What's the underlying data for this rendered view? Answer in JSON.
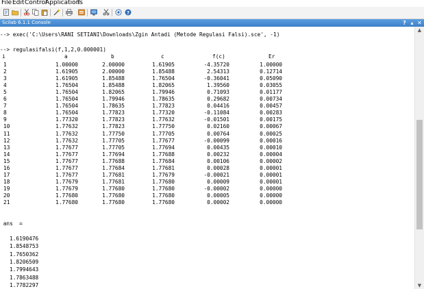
{
  "menu": [
    "File",
    "Edit",
    "Control",
    "Applications",
    "?"
  ],
  "toolbar": [
    "new-script-icon",
    "open-file-icon",
    "cut-icon",
    "copy-icon",
    "paste-icon",
    "wand-icon",
    "print-icon",
    "print-preview-icon",
    "variable-browser-icon",
    "scissors-icon",
    "settings-icon",
    "help-icon"
  ],
  "window": {
    "title": "Scilab 6.1.1 Console",
    "buttons": [
      "?",
      "▴",
      "✕"
    ]
  },
  "console": {
    "exec_line": "--> exec('C:\\Users\\RANI SETIANI\\Downloads\\Zgin Antadi (Metode Regulasi Falsi).sce', -1)",
    "call_line": "--> regulasifalsi(f,1,2,0.000001)",
    "table": {
      "headers": [
        "i",
        "a",
        "b",
        "c",
        "f(c)",
        "Er"
      ],
      "rows": [
        [
          "1",
          "1.00000",
          "2.00000",
          "1.61905",
          "-4.35720",
          "1.00000"
        ],
        [
          "2",
          "1.61905",
          "2.00000",
          "1.85488",
          "2.54313",
          "0.12714"
        ],
        [
          "3",
          "1.61905",
          "1.85488",
          "1.76504",
          "-0.36041",
          "0.05090"
        ],
        [
          "4",
          "1.76504",
          "1.85488",
          "1.82065",
          "1.39560",
          "0.03055"
        ],
        [
          "5",
          "1.76504",
          "1.82065",
          "1.79946",
          "0.71093",
          "0.01177"
        ],
        [
          "6",
          "1.76504",
          "1.79946",
          "1.78635",
          "0.29682",
          "0.00734"
        ],
        [
          "7",
          "1.76504",
          "1.78635",
          "1.77823",
          "0.04416",
          "0.00457"
        ],
        [
          "8",
          "1.76504",
          "1.77823",
          "1.77320",
          "-0.11084",
          "0.00283"
        ],
        [
          "9",
          "1.77320",
          "1.77823",
          "1.77632",
          "-0.01501",
          "0.00175"
        ],
        [
          "10",
          "1.77632",
          "1.77823",
          "1.77750",
          "0.02160",
          "0.00067"
        ],
        [
          "11",
          "1.77632",
          "1.77750",
          "1.77705",
          "0.00764",
          "0.00025"
        ],
        [
          "12",
          "1.77632",
          "1.77705",
          "1.77677",
          "-0.00099",
          "0.00016"
        ],
        [
          "13",
          "1.77677",
          "1.77705",
          "1.77694",
          "0.00435",
          "0.00010"
        ],
        [
          "14",
          "1.77677",
          "1.77694",
          "1.77688",
          "0.00232",
          "0.00004"
        ],
        [
          "15",
          "1.77677",
          "1.77688",
          "1.77684",
          "0.00106",
          "0.00002"
        ],
        [
          "16",
          "1.77677",
          "1.77684",
          "1.77681",
          "0.00028",
          "0.00001"
        ],
        [
          "17",
          "1.77677",
          "1.77681",
          "1.77679",
          "-0.00021",
          "0.00001"
        ],
        [
          "18",
          "1.77679",
          "1.77681",
          "1.77680",
          "0.00009",
          "0.00001"
        ],
        [
          "19",
          "1.77679",
          "1.77680",
          "1.77680",
          "-0.00002",
          "0.00000"
        ],
        [
          "20",
          "1.77680",
          "1.77680",
          "1.77680",
          "0.00005",
          "0.00000"
        ],
        [
          "21",
          "1.77680",
          "1.77680",
          "1.77680",
          "0.00002",
          "0.00000"
        ]
      ]
    },
    "ans_label": " ans  =",
    "ans_values": [
      "1.6190476",
      "1.8548753",
      "1.7650362",
      "1.8206509",
      "1.7994643",
      "1.7863488",
      "1.7782297"
    ]
  },
  "scrollbar": {
    "up_arrow": "▲",
    "down_arrow": "▼",
    "position": 0.62
  },
  "colors": {
    "title_bar": "#3d7fc8",
    "toolbar_bg": "#f3f3f3"
  }
}
